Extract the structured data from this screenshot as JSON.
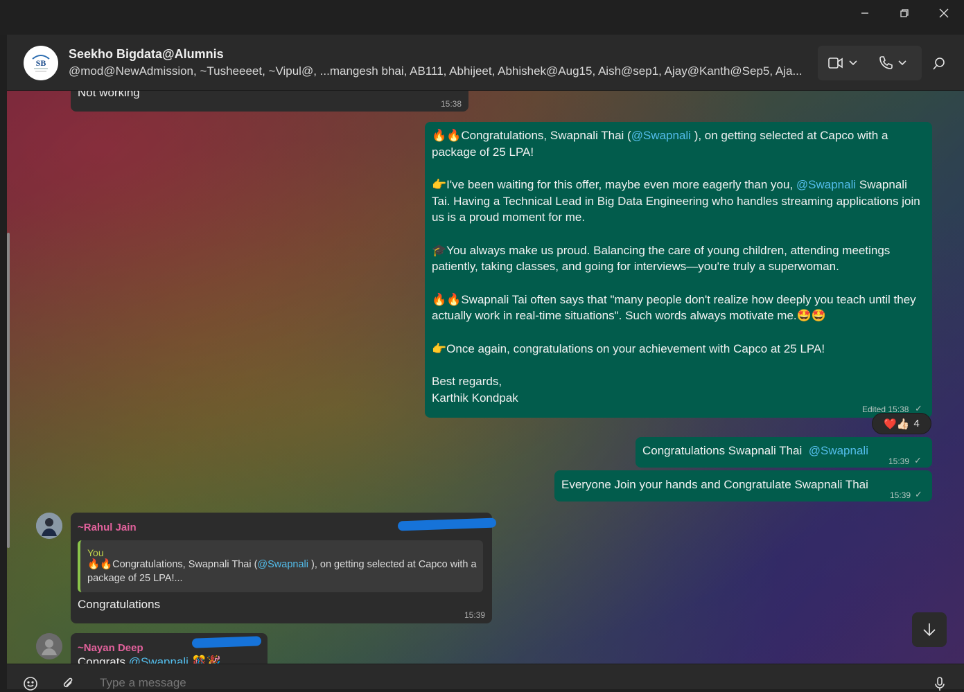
{
  "window": {
    "controls": {
      "minimize": "minimize-icon",
      "restore": "restore-icon",
      "close": "close-icon"
    }
  },
  "header": {
    "title": "Seekho Bigdata@Alumnis",
    "members": "@mod@NewAdmission, ~Tusheeeet, ~Vipul@, ...mangesh bhai, AB111, Abhijeet, Abhishek@Aug15, Aish@sep1, Ajay@Kanth@Sep5, Aja...",
    "avatar_text": "SB",
    "icons": {
      "video": "video-call-icon",
      "voice": "voice-call-icon",
      "search": "search-icon"
    }
  },
  "messages": {
    "prev": {
      "text": "Not working",
      "time": "15:38"
    },
    "main": {
      "p1_a": "🔥🔥Congratulations, Swapnali Thai (",
      "p1_mention": "@Swapnali",
      "p1_b": " ), on getting selected at Capco with a package of 25 LPA!",
      "p2_a": "👉I've been waiting for this offer, maybe even more eagerly than you, ",
      "p2_mention": "@Swapnali",
      "p2_b": " Swapnali Tai. Having a Technical Lead in Big Data Engineering who handles streaming applications join us is a proud moment for me.",
      "p3": "🎓You always make us proud. Balancing the care of young children, attending meetings patiently, taking classes, and going for interviews—you're truly a superwoman.",
      "p4": "🔥🔥Swapnali Tai often says that \"many people don't realize how deeply you teach until they actually work in real-time situations\". Such words always motivate me.🤩🤩",
      "p5": "👉Once again, congratulations on your achievement with Capco at 25 LPA!",
      "p6_a": "Best regards,",
      "p6_b": "Karthik Kondpak",
      "edited": "Edited 15:38",
      "tick": "✓",
      "reactions": "❤️👍🏻",
      "reaction_count": "4"
    },
    "m2": {
      "text": "Congratulations Swapnali Thai ",
      "mention": "@Swapnali",
      "time": "15:39",
      "tick": "✓"
    },
    "m3": {
      "text": "Everyone Join your hands and Congratulate Swapnali Thai",
      "time": "15:39",
      "tick": "✓"
    },
    "rahul": {
      "sender": "~Rahul Jain",
      "quote_author": "You",
      "quote_a": "🔥🔥Congratulations, Swapnali Thai (",
      "quote_mention": "@Swapnali",
      "quote_b": " ), on getting selected at Capco with a package of 25 LPA!...",
      "text": "Congratulations",
      "time": "15:39"
    },
    "nayan": {
      "sender": "~Nayan Deep",
      "text": "Congrats ",
      "mention": "@Swapnali",
      "emoji": "🎊🎉"
    }
  },
  "composer": {
    "placeholder": "Type a message",
    "icons": {
      "emoji": "emoji-icon",
      "attach": "attach-icon",
      "mic": "mic-icon"
    }
  },
  "colors": {
    "outgoing_bubble": "#025c4c",
    "incoming_bubble": "#2c2c2c",
    "mention": "#53bdeb",
    "sender_name": "#e2619c",
    "quote_bar": "#8ac34a"
  }
}
